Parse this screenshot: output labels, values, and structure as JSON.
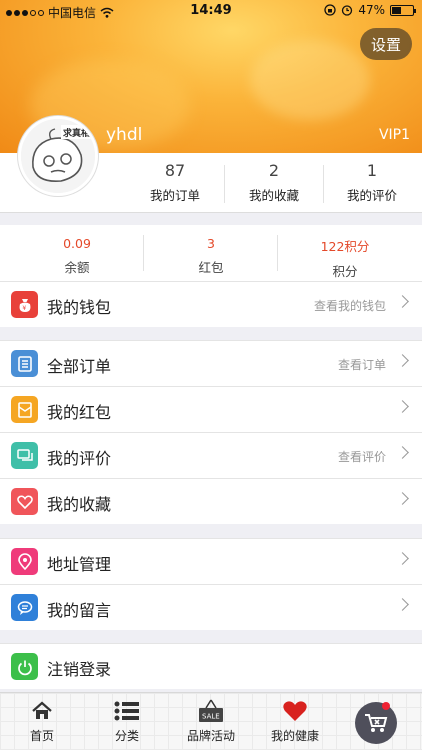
{
  "status_bar": {
    "carrier": "中国电信",
    "time": "14:49",
    "battery": "47%",
    "battery_level": 0.47
  },
  "header": {
    "settings_label": "设置",
    "username": "yhdl",
    "vip_level": "VIP1",
    "avatar_tag": "求真相"
  },
  "stats": [
    {
      "value": "87",
      "label": "我的订单"
    },
    {
      "value": "2",
      "label": "我的收藏"
    },
    {
      "value": "1",
      "label": "我的评价"
    }
  ],
  "balance": [
    {
      "value": "0.09",
      "label": "余额"
    },
    {
      "value": "3",
      "label": "红包"
    },
    {
      "value": "122积分",
      "label": "积分"
    }
  ],
  "menu": {
    "wallet": {
      "label": "我的钱包",
      "hint": "查看我的钱包",
      "icon": "wallet-icon",
      "color": "#e8413a"
    },
    "orders": {
      "label": "全部订单",
      "hint": "查看订单",
      "icon": "order-list-icon",
      "color": "#4a8fd6"
    },
    "red_packets": {
      "label": "我的红包",
      "hint": "",
      "icon": "red-packet-icon",
      "color": "#f5a623"
    },
    "reviews": {
      "label": "我的评价",
      "hint": "查看评价",
      "icon": "comment-icon",
      "color": "#3fbfa8"
    },
    "favorites": {
      "label": "我的收藏",
      "hint": "",
      "icon": "heart-icon",
      "color": "#f0555a"
    },
    "address": {
      "label": "地址管理",
      "hint": "",
      "icon": "location-icon",
      "color": "#ef3b7a"
    },
    "messages": {
      "label": "我的留言",
      "hint": "",
      "icon": "message-icon",
      "color": "#2f80d9"
    },
    "logout": {
      "label": "注销登录",
      "hint": "",
      "icon": "power-icon",
      "color": "#3cbf4a"
    }
  },
  "tabs": [
    {
      "label": "首页",
      "icon": "home-icon"
    },
    {
      "label": "分类",
      "icon": "list-icon"
    },
    {
      "label": "品牌活动",
      "icon": "sale-sign-icon",
      "sign_text": "SALE"
    },
    {
      "label": "我的健康",
      "icon": "heart-icon",
      "color": "#d8221e"
    }
  ]
}
